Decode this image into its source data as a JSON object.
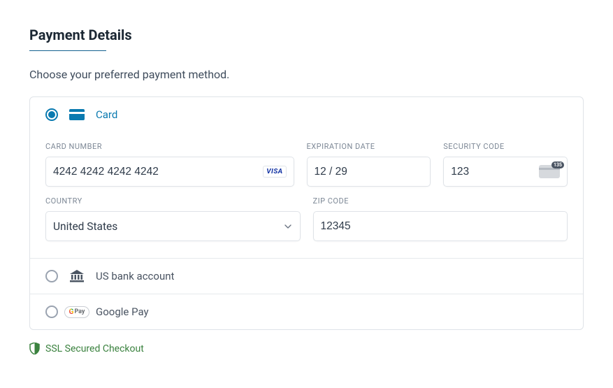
{
  "header": {
    "title": "Payment Details",
    "subtitle": "Choose your preferred payment method."
  },
  "methods": {
    "card": {
      "label": "Card",
      "selected": true
    },
    "bank": {
      "label": "US bank account",
      "selected": false
    },
    "gpay": {
      "label": "Google Pay",
      "selected": false
    }
  },
  "card_form": {
    "card_number": {
      "label": "CARD NUMBER",
      "value": "4242 4242 4242 4242",
      "brand": "VISA"
    },
    "expiry": {
      "label": "EXPIRATION DATE",
      "value": "12 / 29"
    },
    "cvc": {
      "label": "SECURITY CODE",
      "value": "123",
      "hint": "135"
    },
    "country": {
      "label": "COUNTRY",
      "value": "United States"
    },
    "zip": {
      "label": "ZIP CODE",
      "value": "12345"
    }
  },
  "footer": {
    "ssl": "SSL Secured Checkout"
  }
}
